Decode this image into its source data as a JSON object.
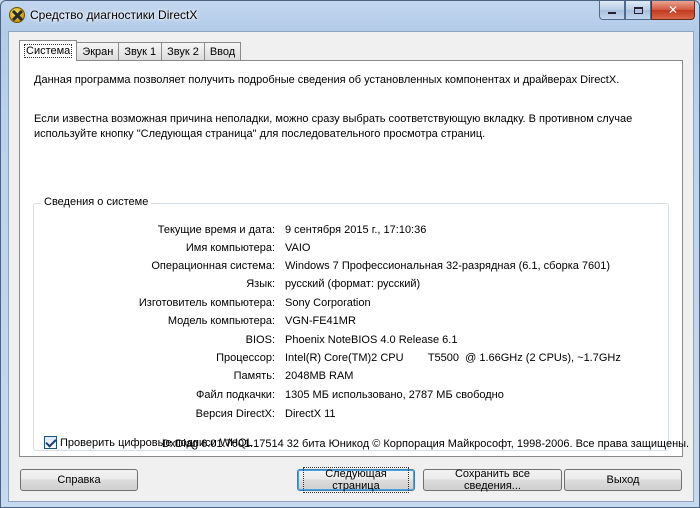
{
  "window": {
    "title": "Средство диагностики DirectX",
    "controls": {
      "minimize": "",
      "maximize": "",
      "close": "✕"
    }
  },
  "tabs": [
    {
      "label": "Система",
      "active": true
    },
    {
      "label": "Экран",
      "active": false
    },
    {
      "label": "Звук 1",
      "active": false
    },
    {
      "label": "Звук 2",
      "active": false
    },
    {
      "label": "Ввод",
      "active": false
    }
  ],
  "intro": {
    "line1": "Данная программа позволяет получить подробные сведения об установленных компонентах и драйверах DirectX.",
    "line2": "Если известна возможная причина неполадки, можно сразу выбрать соответствующую вкладку. В противном случае используйте кнопку \"Следующая страница\" для последовательного просмотра страниц."
  },
  "system_info": {
    "title": "Сведения о системе",
    "rows": [
      {
        "label": "Текущие время и дата:",
        "value": "9 сентября 2015 г., 17:10:36"
      },
      {
        "label": "Имя компьютера:",
        "value": "VAIO"
      },
      {
        "label": "Операционная система:",
        "value": "Windows 7 Профессиональная 32-разрядная (6.1, сборка 7601)"
      },
      {
        "label": "Язык:",
        "value": "русский (формат: русский)"
      },
      {
        "label": "Изготовитель компьютера:",
        "value": "Sony Corporation"
      },
      {
        "label": "Модель компьютера:",
        "value": "VGN-FE41MR"
      },
      {
        "label": "BIOS:",
        "value": "Phoenix NoteBIOS 4.0 Release 6.1"
      },
      {
        "label": "Процессор:",
        "value": "Intel(R) Core(TM)2 CPU        T5500  @ 1.66GHz (2 CPUs), ~1.7GHz"
      },
      {
        "label": "Память:",
        "value": "2048MB RAM"
      },
      {
        "label": "Файл подкачки:",
        "value": "1305 МБ использовано, 2787 МБ свободно"
      },
      {
        "label": "Версия DirectX:",
        "value": "DirectX 11"
      }
    ],
    "whql_checkbox": {
      "label": "Проверить цифровые подписи WHQL",
      "checked": true
    }
  },
  "footer": "DxDiag 6.01.7601.17514 32 бита Юникод  © Корпорация Майкрософт, 1998-2006.  Все права защищены.",
  "buttons": {
    "help": "Справка",
    "next": "Следующая страница",
    "save": "Сохранить все сведения...",
    "exit": "Выход"
  },
  "colors": {
    "frame": "#b3cbe8",
    "client_bg": "#f0f0f0",
    "close_button": "#c23a1f"
  }
}
